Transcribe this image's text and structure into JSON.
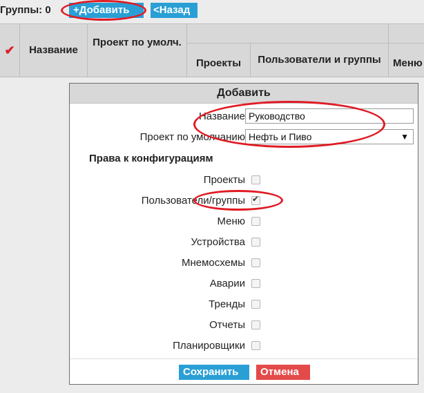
{
  "topbar": {
    "groups_label": "Группы: 0",
    "add_label": "+Добавить",
    "back_label": "<Назад"
  },
  "table": {
    "check_mark": "✔",
    "headers": {
      "name": "Название",
      "default_project": "Проект по умолч.",
      "projects": "Проекты",
      "users_groups": "Пользователи и группы",
      "menu": "Меню"
    }
  },
  "dialog": {
    "title": "Добавить",
    "name_label": "Название",
    "name_value": "Руководство",
    "project_label": "Проект по умолчанию",
    "project_selected": "Нефть и Пиво",
    "select_arrow": "▼",
    "rights_heading": "Права к конфигурациям",
    "permissions": [
      {
        "label": "Проекты",
        "checked": false
      },
      {
        "label": "Пользователи/группы",
        "checked": true
      },
      {
        "label": "Меню",
        "checked": false
      },
      {
        "label": "Устройства",
        "checked": false
      },
      {
        "label": "Мнемосхемы",
        "checked": false
      },
      {
        "label": "Аварии",
        "checked": false
      },
      {
        "label": "Тренды",
        "checked": false
      },
      {
        "label": "Отчеты",
        "checked": false
      },
      {
        "label": "Планировщики",
        "checked": false
      }
    ],
    "save_label": "Сохранить",
    "cancel_label": "Отмена"
  },
  "colors": {
    "accent_blue": "#2a9fd6",
    "cancel_red": "#e44a4a",
    "annotation_red": "#e01b24"
  }
}
